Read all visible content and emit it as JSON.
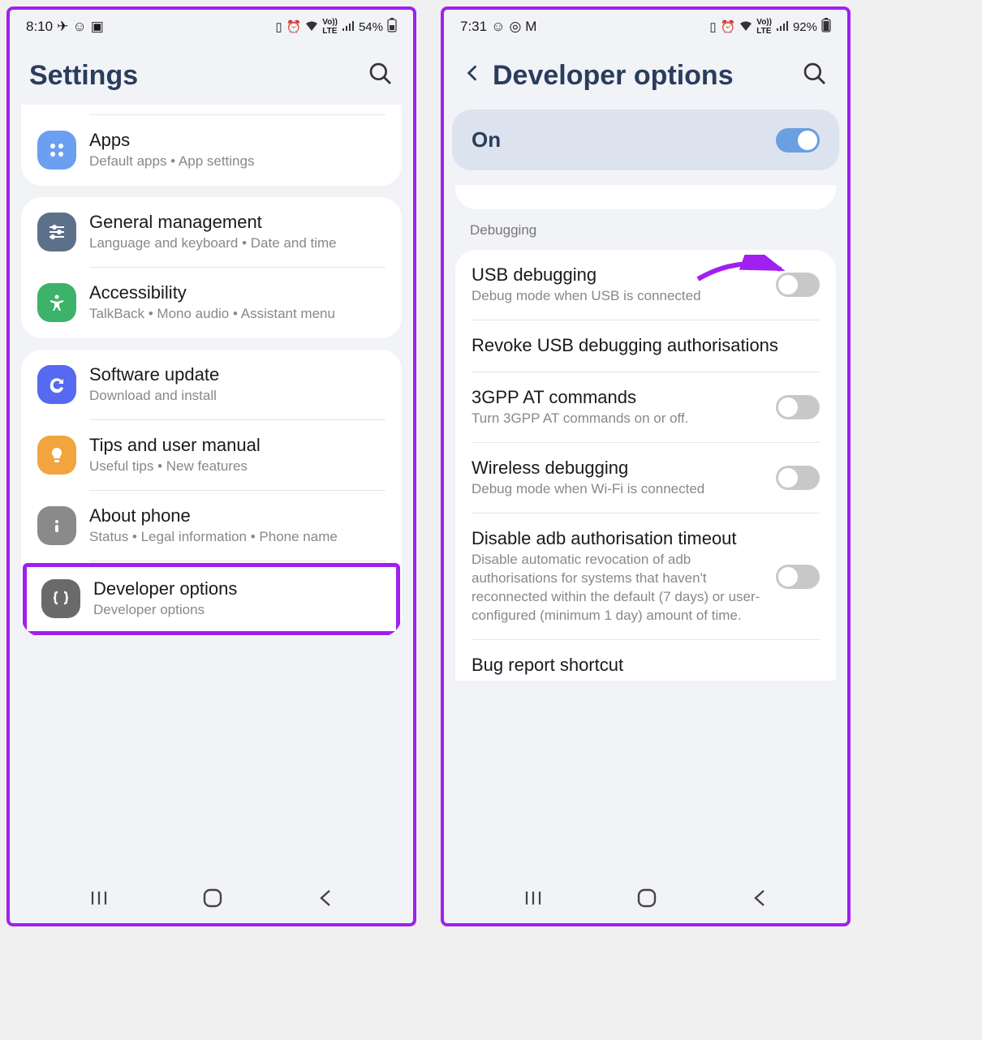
{
  "left": {
    "status": {
      "time": "8:10",
      "battery": "54%"
    },
    "header": {
      "title": "Settings"
    },
    "groups": [
      {
        "truncatedTop": true,
        "items": [
          {
            "id": "apps",
            "title": "Apps",
            "sub": "Default apps  •  App settings",
            "iconBg": "#6b9ff2"
          }
        ]
      },
      {
        "items": [
          {
            "id": "general",
            "title": "General management",
            "sub": "Language and keyboard  •  Date and time",
            "iconBg": "#5c7089"
          },
          {
            "id": "accessibility",
            "title": "Accessibility",
            "sub": "TalkBack  •  Mono audio  •  Assistant menu",
            "iconBg": "#3db26a"
          }
        ]
      },
      {
        "items": [
          {
            "id": "software-update",
            "title": "Software update",
            "sub": "Download and install",
            "iconBg": "#5769f0"
          },
          {
            "id": "tips",
            "title": "Tips and user manual",
            "sub": "Useful tips  •  New features",
            "iconBg": "#f2a43e"
          },
          {
            "id": "about",
            "title": "About phone",
            "sub": "Status  •  Legal information  •  Phone name",
            "iconBg": "#8a8a8a"
          },
          {
            "id": "developer",
            "title": "Developer options",
            "sub": "Developer options",
            "iconBg": "#6a6a6a",
            "highlight": true
          }
        ]
      }
    ]
  },
  "right": {
    "status": {
      "time": "7:31",
      "battery": "92%"
    },
    "header": {
      "title": "Developer options"
    },
    "masterToggle": {
      "label": "On",
      "state": true
    },
    "sectionLabel": "Debugging",
    "items": [
      {
        "id": "usb-debug",
        "title": "USB debugging",
        "sub": "Debug mode when USB is connected",
        "toggle": false,
        "arrow": true
      },
      {
        "id": "revoke",
        "title": "Revoke USB debugging authorisations",
        "sub": ""
      },
      {
        "id": "3gpp",
        "title": "3GPP AT commands",
        "sub": "Turn 3GPP AT commands on or off.",
        "toggle": false
      },
      {
        "id": "wireless-debug",
        "title": "Wireless debugging",
        "sub": "Debug mode when Wi-Fi is connected",
        "toggle": false
      },
      {
        "id": "adb-timeout",
        "title": "Disable adb authorisation timeout",
        "sub": "Disable automatic revocation of adb authorisations for systems that haven't reconnected within the default (7 days) or user-configured (minimum 1 day) amount of time.",
        "toggle": false
      },
      {
        "id": "bug-report",
        "title": "Bug report shortcut",
        "sub": ""
      }
    ]
  }
}
